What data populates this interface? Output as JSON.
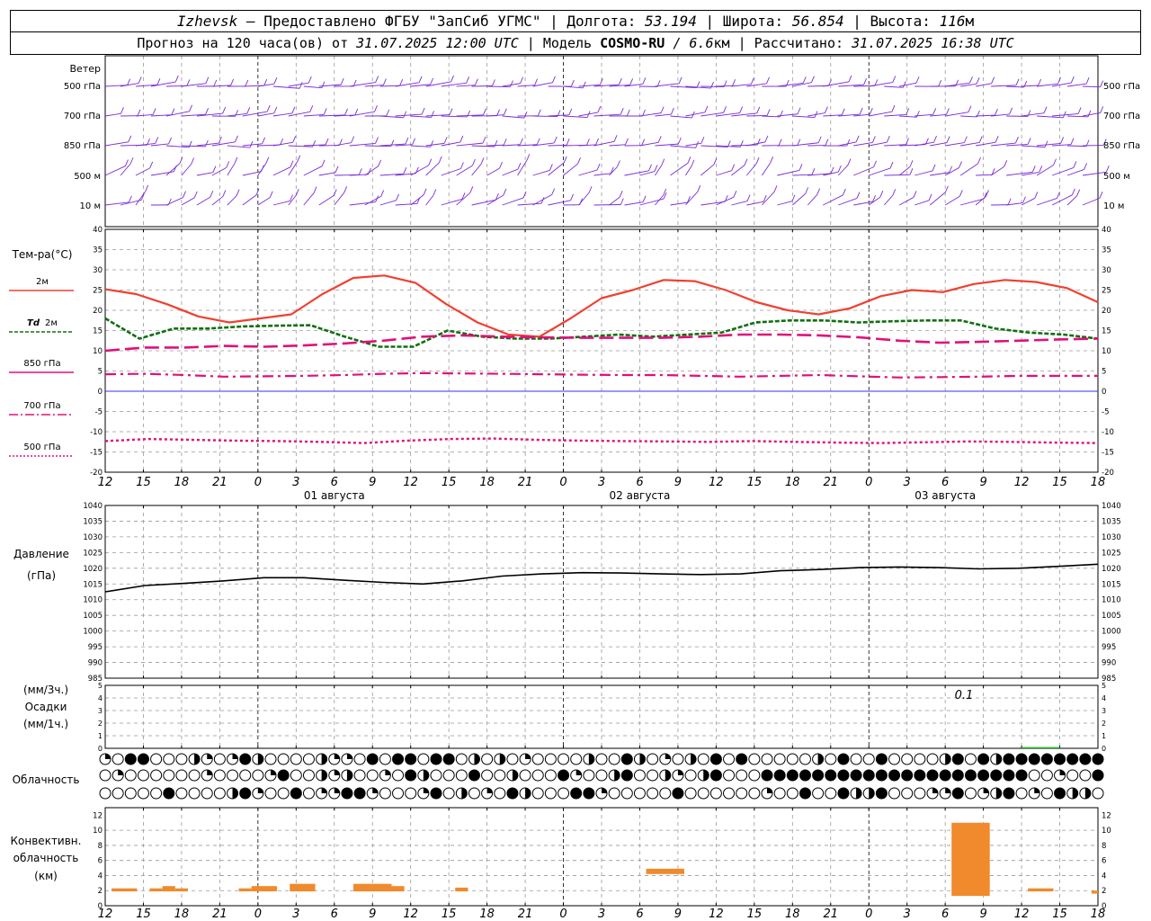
{
  "header": {
    "city": "Izhevsk",
    "provider": " — Предоставлено ФГБУ \"ЗапСиб УГМС\" | Долгота: ",
    "lon": "53.194",
    "lat_label": " | Широта: ",
    "lat": "56.854",
    "alt_label": " | Высота: ",
    "alt": "116",
    "alt_unit": "м",
    "forecast_prefix": "Прогноз на 120 часа(ов) от ",
    "forecast_date": "31.07.2025 12:00 UTC",
    "model_label": " | Модель ",
    "model": "COSMO-RU",
    "model_res": " / 6.6",
    "model_res_unit": "км",
    "calc_label": " | Рассчитано: ",
    "calc_date": "31.07.2025 16:38 UTC"
  },
  "labels": {
    "wind": "Ветер",
    "wind_levels": [
      "500 гПа",
      "700 гПа",
      "850 гПа",
      "500 м",
      "10 м"
    ],
    "temp": "Тем-ра(°С)",
    "t2m": "2м",
    "td": "Td",
    "td2": "2м",
    "t850": "850 гПа",
    "t700": "700 гПа",
    "t500": "500 гПа",
    "pressure": "Давление",
    "pressure_unit": "(гПа)",
    "precip_unit1": "(мм/3ч.)",
    "precip": "Осадки",
    "precip_unit2": "(мм/1ч.)",
    "cloud": "Облачность",
    "conv1": "Конвективн.",
    "conv2": "облачность",
    "conv3": "(км)",
    "precip_annotation": "0.1"
  },
  "colors": {
    "t2m": "#f04030",
    "td": "#107010",
    "t850": "#e0107a",
    "t700": "#e0107a",
    "t500": "#e0107a",
    "pressure": "#000000",
    "wind": "#7a2cd4",
    "precip": "#20c020",
    "conv": "#f08a2c",
    "zero_line": "#3030ff"
  },
  "time_axis": {
    "ticks": [
      "12",
      "15",
      "18",
      "21",
      "0",
      "3",
      "6",
      "9",
      "12",
      "15",
      "18",
      "21",
      "0",
      "3",
      "6",
      "9",
      "12",
      "15",
      "18",
      "21",
      "0",
      "3",
      "6",
      "9",
      "12",
      "15",
      "18"
    ],
    "days": [
      "01 августа",
      "02 августа",
      "03 августа"
    ]
  },
  "chart_data": [
    {
      "type": "line",
      "x_hours": [
        0,
        3,
        6,
        9,
        12,
        15,
        18,
        21,
        24,
        27,
        30,
        33,
        36,
        39,
        42,
        45,
        48,
        51,
        54,
        57,
        60,
        63,
        66,
        69,
        72,
        75,
        78
      ],
      "ylim": [
        -20,
        40
      ],
      "yticks": [
        -20,
        -15,
        -10,
        -5,
        0,
        5,
        10,
        15,
        20,
        25,
        30,
        35,
        40
      ],
      "series": [
        {
          "name": "2м",
          "values": [
            25.2,
            24,
            21.5,
            18.5,
            17,
            18,
            19,
            24,
            28,
            28.6,
            26.8,
            21.5,
            17,
            14,
            13.5,
            18,
            23,
            25,
            27.5,
            27.2,
            25,
            22,
            20,
            19,
            20.5,
            23.5,
            25,
            24.5,
            26.5,
            27.5,
            27,
            25.5,
            22
          ]
        },
        {
          "name": "Td 2м",
          "values": [
            18,
            13,
            15.5,
            15.5,
            16,
            16.2,
            16.3,
            13.5,
            11,
            11,
            15,
            13.5,
            13,
            13,
            13.5,
            14,
            13.5,
            14,
            14.5,
            17,
            17.5,
            17.5,
            17,
            17.3,
            17.5,
            17.5,
            15.5,
            14.5,
            14,
            13
          ]
        },
        {
          "name": "850 гПа",
          "values": [
            10,
            10.8,
            10.8,
            11.2,
            11,
            11.3,
            11.8,
            12.5,
            13.5,
            13.8,
            13.5,
            13.3,
            13.2,
            13.2,
            13.2,
            13.5,
            14,
            14,
            13.8,
            13.3,
            12.5,
            12,
            12.2,
            12.5,
            12.8,
            13
          ]
        },
        {
          "name": "700 гПа",
          "values": [
            4.2,
            4.3,
            4,
            3.6,
            3.7,
            3.8,
            4,
            4.3,
            4.5,
            4.4,
            4.3,
            4.2,
            4.1,
            4,
            4,
            3.8,
            3.6,
            3.8,
            4,
            3.7,
            3.4,
            3.5,
            3.6,
            3.8,
            3.8,
            3.8
          ]
        },
        {
          "name": "500 гПа",
          "values": [
            -12.3,
            -11.8,
            -12,
            -12.2,
            -12.3,
            -12.5,
            -12.8,
            -12.2,
            -11.8,
            -11.7,
            -12,
            -12.2,
            -12.3,
            -12.4,
            -12.5,
            -12.3,
            -12.5,
            -12.7,
            -12.8,
            -12.6,
            -12.4,
            -12.5,
            -12.7,
            -12.8
          ]
        }
      ]
    },
    {
      "type": "line",
      "ylim": [
        985,
        1040
      ],
      "yticks": [
        985,
        990,
        995,
        1000,
        1005,
        1010,
        1015,
        1020,
        1025,
        1030,
        1035,
        1040
      ],
      "series": [
        {
          "name": "Давление",
          "values": [
            1012.5,
            1014.5,
            1015.2,
            1016,
            1017,
            1017,
            1016.2,
            1015.5,
            1015,
            1016,
            1017.5,
            1018.2,
            1018.6,
            1018.5,
            1018.2,
            1018,
            1018.2,
            1019.2,
            1019.6,
            1020.2,
            1020.4,
            1020.2,
            1019.8,
            1020,
            1020.6,
            1021.3
          ]
        }
      ]
    },
    {
      "type": "bar",
      "ylim": [
        0,
        5
      ],
      "yticks": [
        0,
        1,
        2,
        3,
        4,
        5
      ],
      "series": [
        {
          "name": "Осадки",
          "values": [
            {
              "x": 73.5,
              "value": 0.1
            }
          ]
        }
      ]
    },
    {
      "type": "bar",
      "ylim": [
        0,
        13
      ],
      "yticks": [
        0,
        2,
        4,
        6,
        8,
        10,
        12
      ],
      "series": [
        {
          "name": "Конвективн. облачность",
          "ranges": [
            {
              "h1": 0.5,
              "h2": 2.5,
              "bot": 1.9,
              "top": 2.3
            },
            {
              "h1": 3.5,
              "h2": 4.5,
              "bot": 1.9,
              "top": 2.3
            },
            {
              "h1": 4.5,
              "h2": 5.5,
              "bot": 1.9,
              "top": 2.6
            },
            {
              "h1": 5.5,
              "h2": 6.5,
              "bot": 1.9,
              "top": 2.3
            },
            {
              "h1": 10.5,
              "h2": 11.5,
              "bot": 1.9,
              "top": 2.3
            },
            {
              "h1": 11.5,
              "h2": 13.5,
              "bot": 1.9,
              "top": 2.6
            },
            {
              "h1": 14.5,
              "h2": 16.5,
              "bot": 1.9,
              "top": 2.9
            },
            {
              "h1": 19.5,
              "h2": 22.5,
              "bot": 1.9,
              "top": 2.9
            },
            {
              "h1": 22.5,
              "h2": 23.5,
              "bot": 1.9,
              "top": 2.6
            },
            {
              "h1": 27.5,
              "h2": 28.5,
              "bot": 1.9,
              "top": 2.4
            },
            {
              "h1": 42.5,
              "h2": 45.5,
              "bot": 4.2,
              "top": 4.9
            },
            {
              "h1": 66.5,
              "h2": 69.5,
              "bot": 1.3,
              "top": 11
            },
            {
              "h1": 72.5,
              "h2": 74.5,
              "bot": 1.9,
              "top": 2.3
            },
            {
              "h1": 77.5,
              "h2": 78,
              "bot": 1.6,
              "top": 2
            }
          ]
        }
      ]
    }
  ]
}
